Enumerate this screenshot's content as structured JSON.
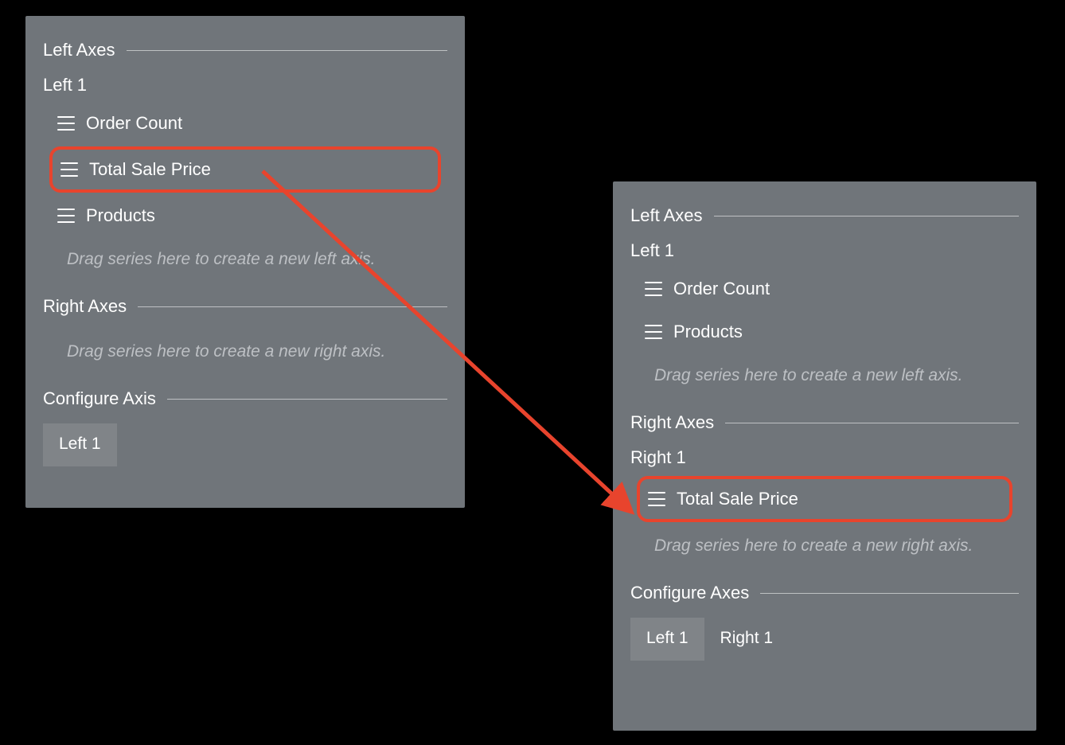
{
  "arrow_color": "#e8442d",
  "panelA": {
    "sections": {
      "leftAxes": {
        "title": "Left Axes",
        "axisName": "Left 1",
        "series": [
          "Order Count",
          "Total Sale Price",
          "Products"
        ],
        "highlightIndex": 1,
        "dropHint": "Drag series here to create a new left axis."
      },
      "rightAxes": {
        "title": "Right Axes",
        "dropHint": "Drag series here to create a new right axis."
      },
      "configure": {
        "title": "Configure Axis",
        "tabs": [
          "Left 1"
        ],
        "activeIndex": 0
      }
    }
  },
  "panelB": {
    "sections": {
      "leftAxes": {
        "title": "Left Axes",
        "axisName": "Left 1",
        "series": [
          "Order Count",
          "Products"
        ],
        "dropHint": "Drag series here to create a new left axis."
      },
      "rightAxes": {
        "title": "Right Axes",
        "axisName": "Right 1",
        "series": [
          "Total Sale Price"
        ],
        "highlightIndex": 0,
        "dropHint": "Drag series here to create a new right axis."
      },
      "configure": {
        "title": "Configure Axes",
        "tabs": [
          "Left 1",
          "Right 1"
        ],
        "activeIndex": 0
      }
    }
  }
}
